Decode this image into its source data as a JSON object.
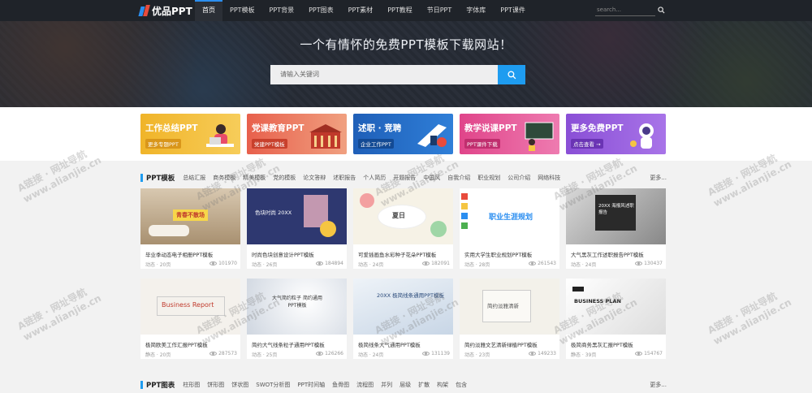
{
  "logo": {
    "text": "优品PPT"
  },
  "nav": [
    "首页",
    "PPT模板",
    "PPT背景",
    "PPT图表",
    "PPT素材",
    "PPT教程",
    "节日PPT",
    "字体库",
    "PPT课件"
  ],
  "top_search": {
    "placeholder": "search..."
  },
  "hero": {
    "title": "一个有情怀的免费PPT模板下载网站！",
    "search_placeholder": "请输入关键词"
  },
  "categories": [
    {
      "title": "工作总结PPT",
      "sub": "更多专题PPT",
      "color": "#f0b429"
    },
    {
      "title": "党课教育PPT",
      "sub": "党建PPT模板",
      "color": "#e8604c"
    },
    {
      "title": "述职 · 竞聘",
      "sub": "企业工作PPT",
      "color": "#1f5fb8"
    },
    {
      "title": "教学说课PPT",
      "sub": "PPT课件下载",
      "color": "#e0458a"
    },
    {
      "title": "更多免费PPT",
      "sub": "点击查看 →",
      "color": "#8a4fd6"
    }
  ],
  "sections": [
    {
      "title": "PPT模板",
      "tags": [
        "总结汇报",
        "商务模板",
        "精美模板",
        "党的模板",
        "论文答辩",
        "述职报告",
        "个人简历",
        "开题报告",
        "中国风",
        "自我介绍",
        "职业规划",
        "公司介绍",
        "网络科技"
      ],
      "more": "更多..."
    },
    {
      "title": "PPT图表",
      "tags": [
        "柱形图",
        "饼形图",
        "饼状图",
        "SWOT分析图",
        "PPT时间轴",
        "鱼骨图",
        "流程图",
        "并列",
        "层级",
        "扩散",
        "构架",
        "包含"
      ],
      "more": "更多..."
    }
  ],
  "cards": [
    {
      "title": "毕业季动态电子相册PPT模板",
      "type": "动态 · 20页",
      "views": "101970",
      "thumb_text": "青春不散场"
    },
    {
      "title": "时尚色块创意设计PPT模板",
      "type": "动态 · 26页",
      "views": "184894",
      "thumb_text": "色块时尚 20XX"
    },
    {
      "title": "可爱插画鱼水彩种子花朵PPT模板",
      "type": "动态 · 24页",
      "views": "182091",
      "thumb_text": "夏日"
    },
    {
      "title": "实用大学生职业规划PPT模板",
      "type": "动态 · 28页",
      "views": "261543",
      "thumb_text": "职业生涯规划"
    },
    {
      "title": "大气黑灰工作述职报告PPT模板",
      "type": "动态 · 24页",
      "views": "130437",
      "thumb_text": "20XX 海报风述职报告"
    },
    {
      "title": "极简欧美工作汇报PPT模板",
      "type": "静态 · 20页",
      "views": "287573",
      "thumb_text": "Business Report"
    },
    {
      "title": "简约大气线条粒子通用PPT模板",
      "type": "动态 · 25页",
      "views": "126266",
      "thumb_text": "大气简约粒子 简约通用PPT模板"
    },
    {
      "title": "极简线条大气通用PPT模板",
      "type": "动态 · 24页",
      "views": "131139",
      "thumb_text": "20XX 极简线条通用PPT模板"
    },
    {
      "title": "简约淡雅文艺清新绿植PPT模板",
      "type": "动态 · 23页",
      "views": "149233",
      "thumb_text": "简约淡雅清新"
    },
    {
      "title": "极简商务黑灰汇报PPT模板",
      "type": "静态 · 39页",
      "views": "154767",
      "thumb_text": "BUSINESS PLAN"
    }
  ],
  "watermark": {
    "line1": "A链接 · 网址导航",
    "line2": "www.alianjie.cn"
  },
  "colors": {
    "accent": "#1e9cf0",
    "topbar": "#1f2329"
  }
}
